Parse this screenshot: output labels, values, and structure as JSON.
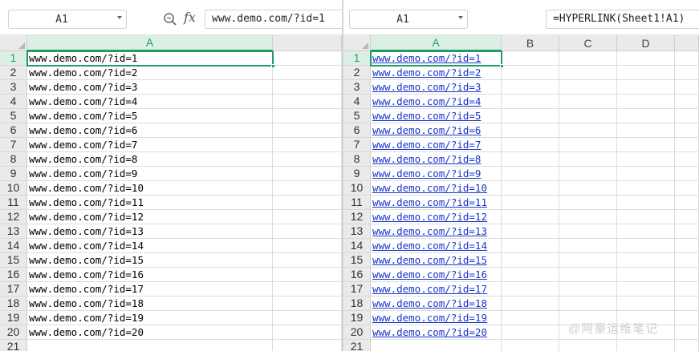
{
  "left_pane": {
    "name_box": "A1",
    "formula": "www.demo.com/?id=1",
    "columns": [
      "A"
    ],
    "active_column": "A",
    "row_numbers": [
      "1",
      "2",
      "3",
      "4",
      "5",
      "6",
      "7",
      "8",
      "9",
      "10",
      "11",
      "12",
      "13",
      "14",
      "15",
      "16",
      "17",
      "18",
      "19",
      "20",
      "21"
    ],
    "active_row": "1",
    "cells_a": [
      "www.demo.com/?id=1",
      "www.demo.com/?id=2",
      "www.demo.com/?id=3",
      "www.demo.com/?id=4",
      "www.demo.com/?id=5",
      "www.demo.com/?id=6",
      "www.demo.com/?id=7",
      "www.demo.com/?id=8",
      "www.demo.com/?id=9",
      "www.demo.com/?id=10",
      "www.demo.com/?id=11",
      "www.demo.com/?id=12",
      "www.demo.com/?id=13",
      "www.demo.com/?id=14",
      "www.demo.com/?id=15",
      "www.demo.com/?id=16",
      "www.demo.com/?id=17",
      "www.demo.com/?id=18",
      "www.demo.com/?id=19",
      "www.demo.com/?id=20",
      ""
    ]
  },
  "right_pane": {
    "name_box": "A1",
    "formula": "=HYPERLINK(Sheet1!A1)",
    "columns": [
      "A",
      "B",
      "C",
      "D"
    ],
    "active_column": "A",
    "row_numbers": [
      "1",
      "2",
      "3",
      "4",
      "5",
      "6",
      "7",
      "8",
      "9",
      "10",
      "11",
      "12",
      "13",
      "14",
      "15",
      "16",
      "17",
      "18",
      "19",
      "20",
      "21"
    ],
    "active_row": "1",
    "cells_a": [
      "www.demo.com/?id=1",
      "www.demo.com/?id=2",
      "www.demo.com/?id=3",
      "www.demo.com/?id=4",
      "www.demo.com/?id=5",
      "www.demo.com/?id=6",
      "www.demo.com/?id=7",
      "www.demo.com/?id=8",
      "www.demo.com/?id=9",
      "www.demo.com/?id=10",
      "www.demo.com/?id=11",
      "www.demo.com/?id=12",
      "www.demo.com/?id=13",
      "www.demo.com/?id=14",
      "www.demo.com/?id=15",
      "www.demo.com/?id=16",
      "www.demo.com/?id=17",
      "www.demo.com/?id=18",
      "www.demo.com/?id=19",
      "www.demo.com/?id=20",
      ""
    ]
  },
  "icons": {
    "zoom": "zoom-magnifier-icon",
    "fx": "fx-icon",
    "dropdown": "chevron-down-icon"
  },
  "fx_label": "fx",
  "watermark": "@阿豪运维笔记",
  "colors": {
    "accent_green": "#1e9e63",
    "link_blue": "#1a35c8",
    "header_bg": "#eaeaea",
    "active_header_bg": "#dcefe5"
  }
}
